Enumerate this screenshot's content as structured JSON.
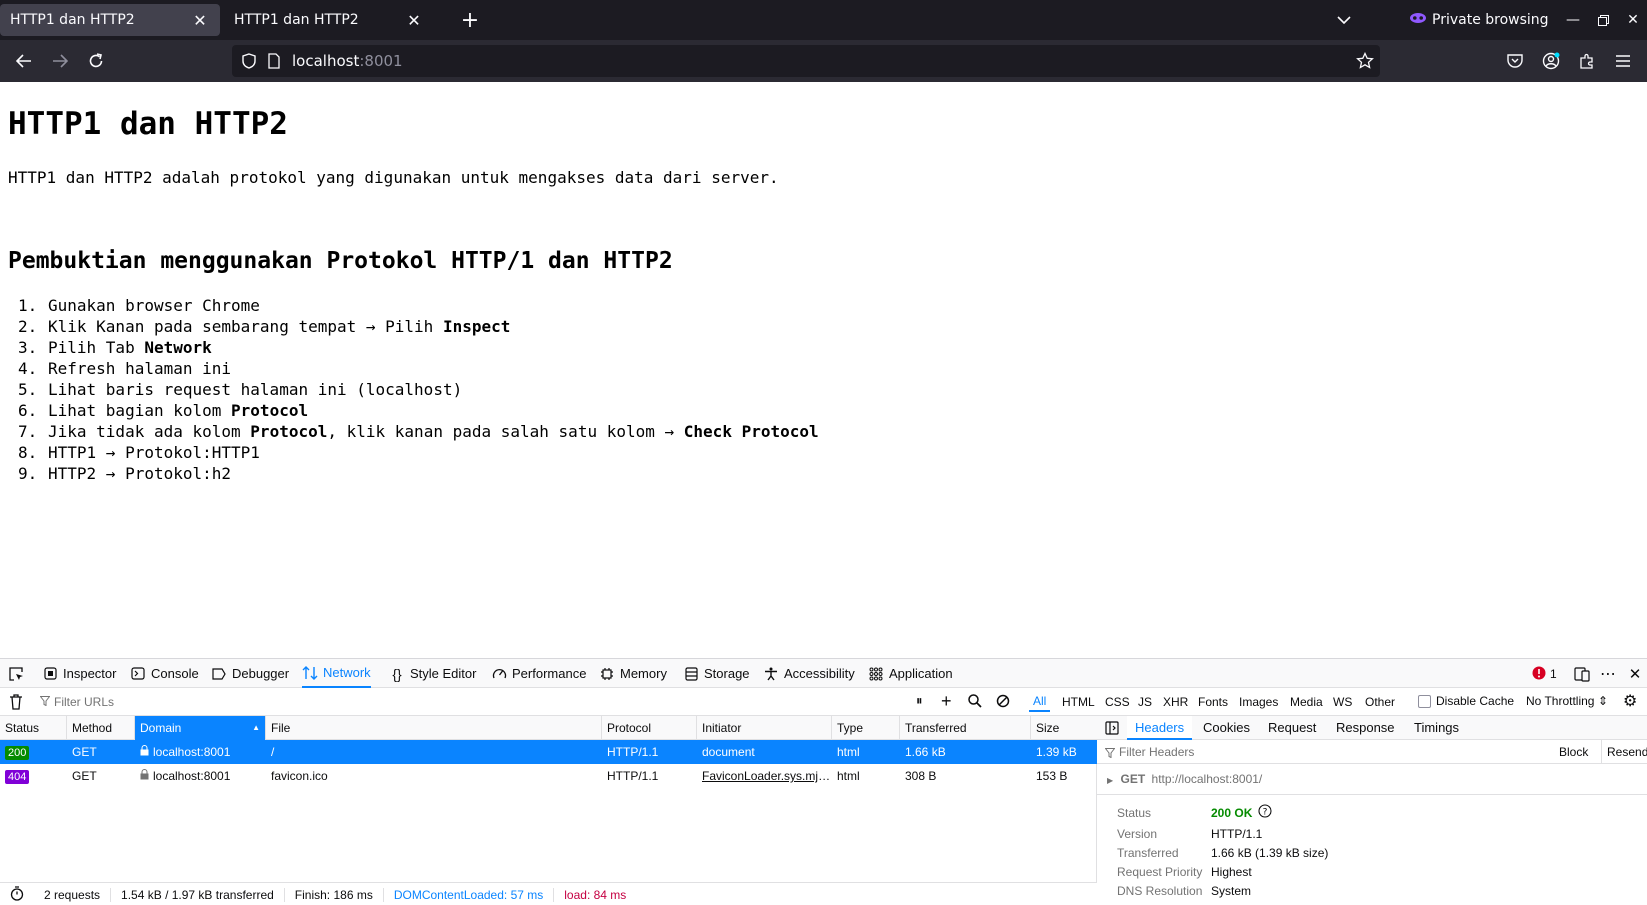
{
  "browser": {
    "tabs": [
      {
        "title": "HTTP1 dan HTTP2",
        "active": true
      },
      {
        "title": "HTTP1 dan HTTP2",
        "active": false
      }
    ],
    "private_label": "Private browsing",
    "url_host": "localhost",
    "url_port": ":8001"
  },
  "page": {
    "title": "HTTP1 dan HTTP2",
    "lead": "HTTP1 dan HTTP2 adalah protokol yang digunakan untuk mengakses data dari server.",
    "subtitle": "Pembuktian menggunakan Protokol HTTP/1 dan HTTP2",
    "steps": [
      {
        "num": "1.",
        "pre": "Gunakan browser Chrome",
        "bold": "",
        "post": "",
        "bold2": ""
      },
      {
        "num": "2.",
        "pre": "Klik Kanan pada sembarang tempat → Pilih ",
        "bold": "Inspect",
        "post": "",
        "bold2": ""
      },
      {
        "num": "3.",
        "pre": "Pilih Tab ",
        "bold": "Network",
        "post": "",
        "bold2": ""
      },
      {
        "num": "4.",
        "pre": "Refresh halaman ini",
        "bold": "",
        "post": "",
        "bold2": ""
      },
      {
        "num": "5.",
        "pre": "Lihat baris request halaman ini (localhost)",
        "bold": "",
        "post": "",
        "bold2": ""
      },
      {
        "num": "6.",
        "pre": "Lihat bagian kolom ",
        "bold": "Protocol",
        "post": "",
        "bold2": ""
      },
      {
        "num": "7.",
        "pre": "Jika tidak ada kolom ",
        "bold": "Protocol",
        "post": ", klik kanan pada salah satu kolom → ",
        "bold2": "Check Protocol"
      },
      {
        "num": "8.",
        "pre": "HTTP1 → Protokol:HTTP1",
        "bold": "",
        "post": "",
        "bold2": ""
      },
      {
        "num": "9.",
        "pre": "HTTP2 → Protokol:h2",
        "bold": "",
        "post": "",
        "bold2": ""
      }
    ]
  },
  "devtools": {
    "tabs": [
      "Inspector",
      "Console",
      "Debugger",
      "Network",
      "Style Editor",
      "Performance",
      "Memory",
      "Storage",
      "Accessibility",
      "Application"
    ],
    "error_count": "1",
    "filter_placeholder": "Filter URLs",
    "type_filters": [
      "All",
      "HTML",
      "CSS",
      "JS",
      "XHR",
      "Fonts",
      "Images",
      "Media",
      "WS",
      "Other"
    ],
    "disable_cache": "Disable Cache",
    "throttling": "No Throttling",
    "columns": [
      "Status",
      "Method",
      "Domain",
      "File",
      "Protocol",
      "Initiator",
      "Type",
      "Transferred",
      "Size"
    ],
    "requests": [
      {
        "status": "200",
        "method": "GET",
        "domain": "localhost:8001",
        "file": "/",
        "protocol": "HTTP/1.1",
        "initiator": "document",
        "type": "html",
        "transferred": "1.66 kB",
        "size": "1.39 kB"
      },
      {
        "status": "404",
        "method": "GET",
        "domain": "localhost:8001",
        "file": "favicon.ico",
        "protocol": "HTTP/1.1",
        "initiator": "FaviconLoader.sys.mjs:...",
        "type": "html",
        "transferred": "308 B",
        "size": "153 B"
      }
    ],
    "status_bar": {
      "requests": "2 requests",
      "size": "1.54 kB / 1.97 kB transferred",
      "finish": "Finish: 186 ms",
      "dom": "DOMContentLoaded: 57 ms",
      "load": "load: 84 ms"
    },
    "side_tabs": [
      "Headers",
      "Cookies",
      "Request",
      "Response",
      "Timings"
    ],
    "side_filter": "Filter Headers",
    "block": "Block",
    "resend": "Resend",
    "request_line": {
      "method": "GET",
      "url": "http://localhost:8001/"
    },
    "headers": [
      {
        "label": "Status",
        "value": "200 OK"
      },
      {
        "label": "Version",
        "value": "HTTP/1.1"
      },
      {
        "label": "Transferred",
        "value": "1.66 kB (1.39 kB size)"
      },
      {
        "label": "Request Priority",
        "value": "Highest"
      },
      {
        "label": "DNS Resolution",
        "value": "System"
      }
    ]
  },
  "colors": {
    "accent": "#0a84ff",
    "ok": "#058b00",
    "error": "#8000d7",
    "load": "#c50042"
  }
}
